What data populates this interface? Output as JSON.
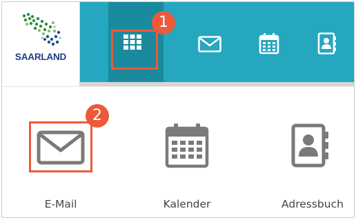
{
  "logo": {
    "text": "SAARLAND",
    "icon": "saarland-map-logo"
  },
  "toolbar": {
    "apps_icon": "grid-icon",
    "icons": [
      "mail-icon",
      "calendar-icon",
      "address-book-icon"
    ]
  },
  "markers": {
    "first": "1",
    "second": "2"
  },
  "apps": [
    {
      "label": "E-Mail",
      "icon": "mail-icon"
    },
    {
      "label": "Kalender",
      "icon": "calendar-icon"
    },
    {
      "label": "Adressbuch",
      "icon": "address-book-icon"
    }
  ],
  "colors": {
    "toolbar": "#25a7c0",
    "toolbar_active": "#1a8a9e",
    "highlight": "#ec5a3b",
    "icon_gray": "#7a7a7a",
    "logo_text": "#1e3e7b"
  }
}
